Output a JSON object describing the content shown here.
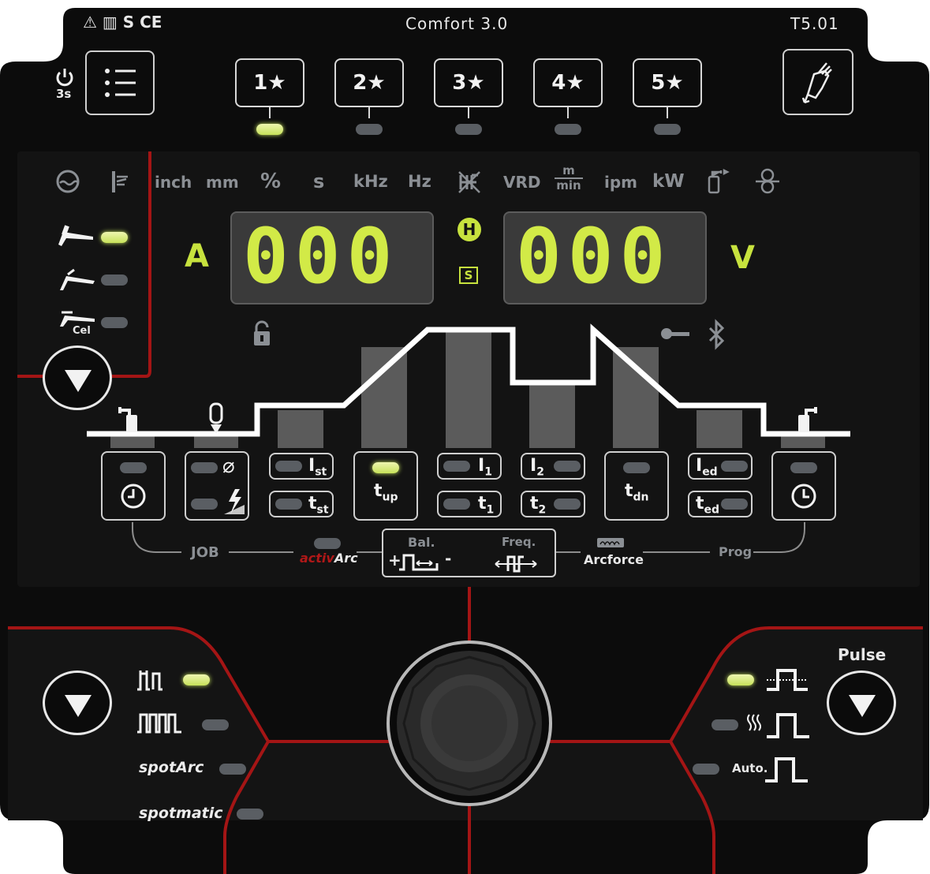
{
  "header": {
    "certifications": "⚠ ▥ S CE",
    "model": "Comfort 3.0",
    "version": "T5.01"
  },
  "power": {
    "hold_label": "3s"
  },
  "favourites": [
    {
      "label": "1★",
      "led": "on"
    },
    {
      "label": "2★",
      "led": "off"
    },
    {
      "label": "3★",
      "led": "off"
    },
    {
      "label": "4★",
      "led": "off"
    },
    {
      "label": "5★",
      "led": "off"
    }
  ],
  "units": [
    "inch",
    "mm",
    "%",
    "s",
    "kHz",
    "Hz",
    "VRD",
    "ipm",
    "kW"
  ],
  "units_fraction": {
    "num": "m",
    "den": "min"
  },
  "displays": {
    "left_value": "000",
    "left_unit": "A",
    "right_value": "000",
    "right_unit": "V",
    "mid_top": "H",
    "mid_bottom": "S"
  },
  "electrode_modes": [
    {
      "icon": "tig-torch-icon",
      "led": "on"
    },
    {
      "icon": "mma-electrode-icon",
      "led": "off"
    },
    {
      "icon": "cel-electrode-icon",
      "label": "Cel",
      "led": "off"
    }
  ],
  "process_params": {
    "gas_pre": {
      "led": "off"
    },
    "diameter_ignition": {
      "leds": [
        "off",
        "off"
      ]
    },
    "i_start": {
      "main": "I",
      "sub": "st"
    },
    "t_start": {
      "main": "t",
      "sub": "st"
    },
    "t_up": {
      "main": "t",
      "sub": "up",
      "led": "on"
    },
    "i1": {
      "main": "I",
      "sub": "1"
    },
    "t1": {
      "main": "t",
      "sub": "1"
    },
    "i2": {
      "main": "I",
      "sub": "2"
    },
    "t2": {
      "main": "t",
      "sub": "2"
    },
    "t_down": {
      "main": "t",
      "sub": "dn",
      "led": "off"
    },
    "i_end": {
      "main": "I",
      "sub": "ed"
    },
    "t_end": {
      "main": "t",
      "sub": "ed"
    },
    "gas_post": {
      "led": "off"
    }
  },
  "bottom_labels": {
    "job": "JOB",
    "activ": "activ",
    "arc": "Arc",
    "bal": "Bal.",
    "freq": "Freq.",
    "plus": "+",
    "minus": "-",
    "arcforce": "Arcforce",
    "prog": "Prog"
  },
  "operating_modes": [
    {
      "icon": "2-stroke-icon",
      "led": "on"
    },
    {
      "icon": "4-stroke-icon",
      "led": "off"
    },
    {
      "label": "spotArc",
      "led": "off"
    },
    {
      "label": "spotmatic",
      "led": "off"
    }
  ],
  "pulse": {
    "label": "Pulse",
    "auto_label": "Auto.",
    "modes": [
      {
        "icon": "pulse-average-icon",
        "led": "on"
      },
      {
        "icon": "thermal-pulse-icon",
        "led": "off"
      },
      {
        "icon": "auto-pulse-icon",
        "led": "off"
      }
    ]
  },
  "colors": {
    "panel": "#0c0c0c",
    "display_area": "#131313",
    "accent_green": "#d2ea47",
    "red_trim": "#a41515",
    "led_off": "#5a5e63"
  }
}
